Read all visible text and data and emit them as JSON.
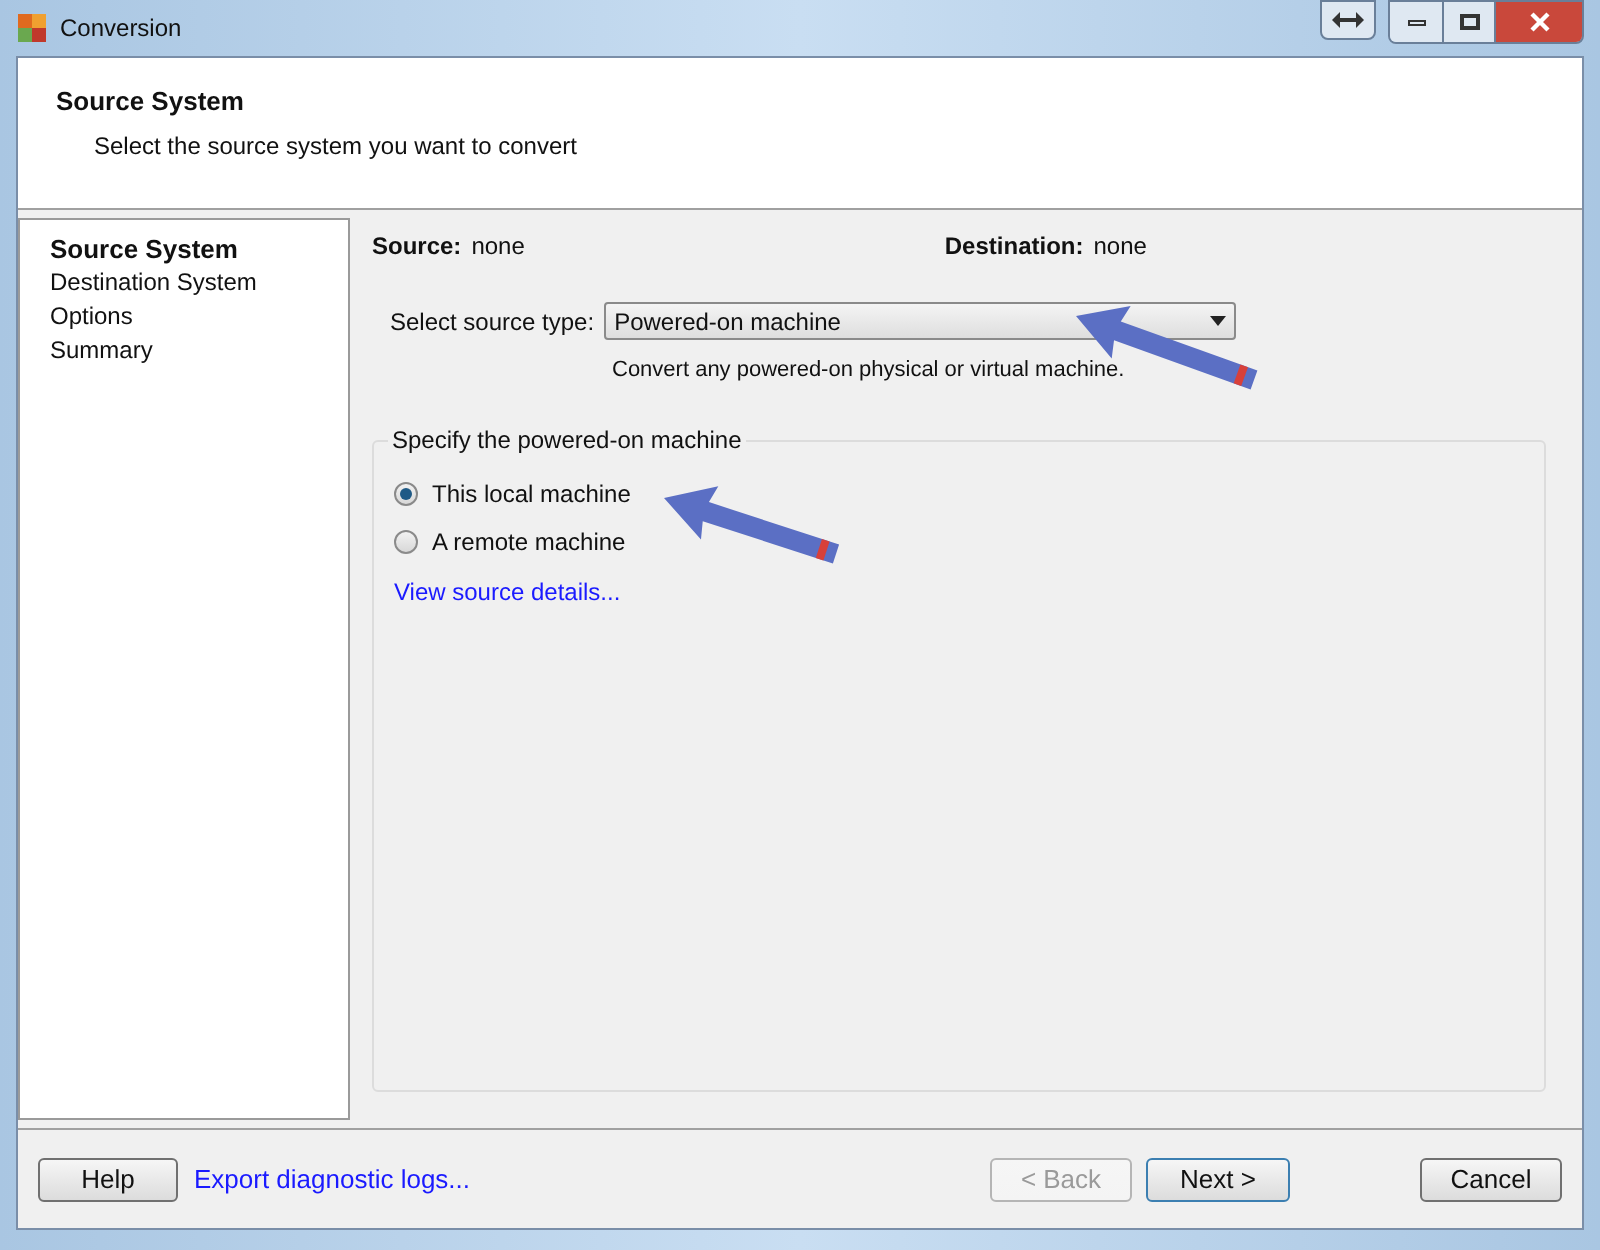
{
  "window": {
    "title": "Conversion"
  },
  "header": {
    "title": "Source System",
    "subtitle": "Select the source system you want to convert"
  },
  "steps": [
    {
      "label": "Source System",
      "selected": true
    },
    {
      "label": "Destination System",
      "selected": false
    },
    {
      "label": "Options",
      "selected": false
    },
    {
      "label": "Summary",
      "selected": false
    }
  ],
  "summary": {
    "source_label": "Source:",
    "source_value": "none",
    "destination_label": "Destination:",
    "destination_value": "none"
  },
  "source_type": {
    "label": "Select source type:",
    "value": "Powered-on machine",
    "hint": "Convert any powered-on physical or virtual machine."
  },
  "group": {
    "title": "Specify the powered-on machine",
    "options": [
      {
        "label": "This local machine",
        "selected": true
      },
      {
        "label": "A remote machine",
        "selected": false
      }
    ],
    "link": "View source details..."
  },
  "footer": {
    "help": "Help",
    "export_link": "Export diagnostic logs...",
    "back": {
      "label": "< Back",
      "disabled": true
    },
    "next": {
      "label": "Next >",
      "default": true
    },
    "cancel": "Cancel"
  }
}
